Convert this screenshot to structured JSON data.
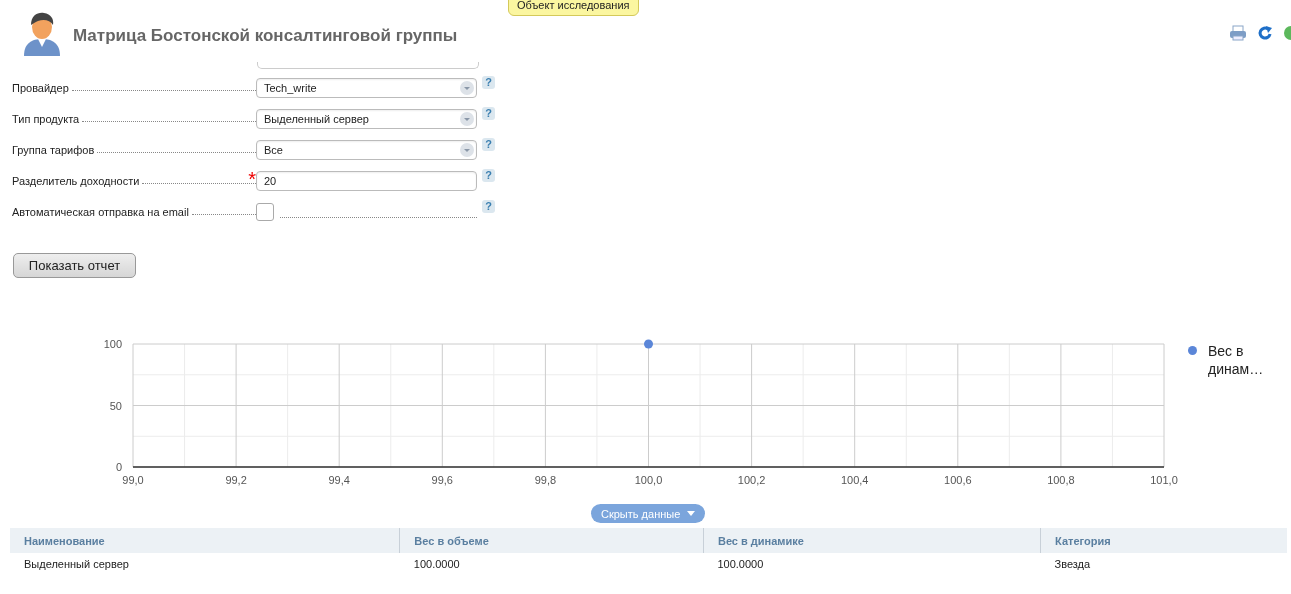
{
  "header": {
    "title": "Матрица Бостонской консалтинговой группы"
  },
  "tooltip": {
    "text": "Объект исследования"
  },
  "form": {
    "fields": [
      {
        "label": "Провайдер",
        "kind": "select",
        "value": "Tech_write",
        "required": false
      },
      {
        "label": "Тип продукта",
        "kind": "select",
        "value": "Выделенный сервер",
        "required": false
      },
      {
        "label": "Группа тарифов",
        "kind": "select",
        "value": "Все",
        "required": false
      },
      {
        "label": "Разделитель доходности",
        "kind": "text",
        "value": "20",
        "required": true
      },
      {
        "label": "Автоматическая отправка на email",
        "kind": "checkbox",
        "checked": false,
        "required": false
      }
    ],
    "help_mark": "?",
    "required_mark": "*",
    "submit": "Показать отчет"
  },
  "chart": {
    "chart_data": {
      "type": "scatter",
      "x": [
        100.0
      ],
      "series": [
        {
          "name": "Вес в динам…",
          "color": "#5b86d8",
          "values": [
            100
          ]
        }
      ],
      "xlim": [
        99,
        101
      ],
      "ylim": [
        0,
        100
      ],
      "xticks": [
        {
          "value": 99.0,
          "label": "99,0"
        },
        {
          "value": 99.2,
          "label": "99,2"
        },
        {
          "value": 99.4,
          "label": "99,4"
        },
        {
          "value": 99.6,
          "label": "99,6"
        },
        {
          "value": 99.8,
          "label": "99,8"
        },
        {
          "value": 100.0,
          "label": "100,0"
        },
        {
          "value": 100.2,
          "label": "100,2"
        },
        {
          "value": 100.4,
          "label": "100,4"
        },
        {
          "value": 100.6,
          "label": "100,6"
        },
        {
          "value": 100.8,
          "label": "100,8"
        },
        {
          "value": 101.0,
          "label": "101,0"
        }
      ],
      "yticks": [
        0,
        50,
        100
      ],
      "grid": true
    }
  },
  "toggle": {
    "label": "Скрыть данные"
  },
  "table": {
    "columns": [
      "Наименование",
      "Вес в объеме",
      "Вес в динамике",
      "Категория"
    ],
    "rows": [
      [
        "Выделенный сервер",
        "100.0000",
        "100.0000",
        "Звезда"
      ]
    ]
  }
}
